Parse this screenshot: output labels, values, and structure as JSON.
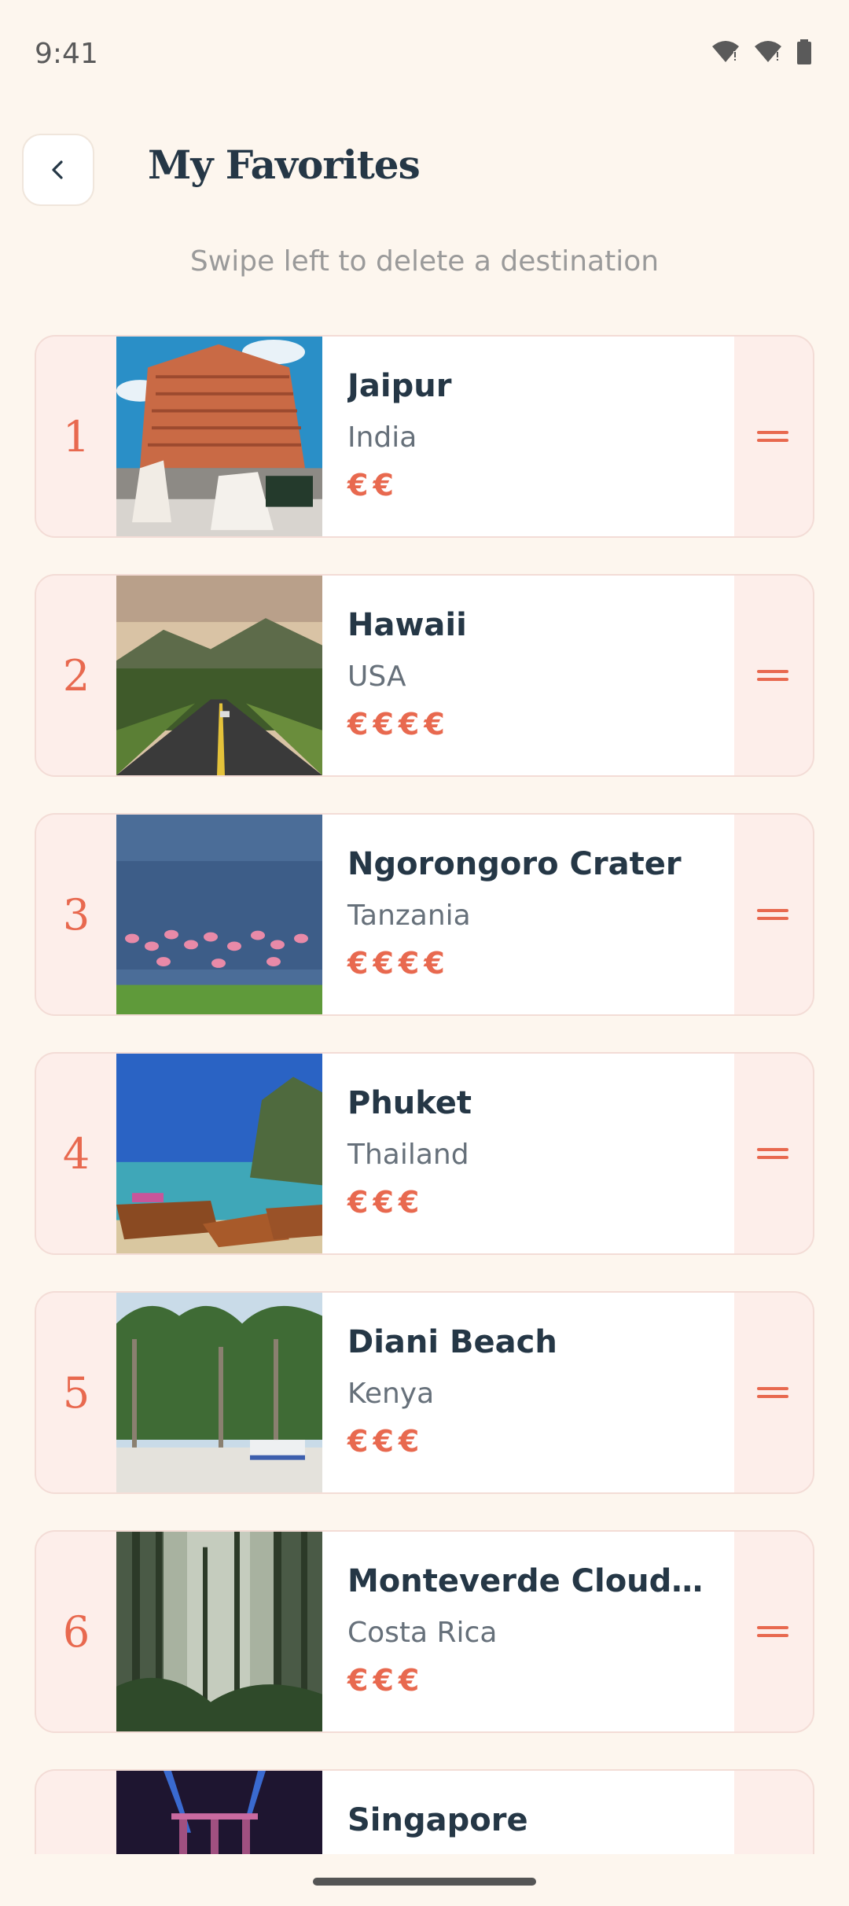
{
  "status_bar": {
    "time": "9:41"
  },
  "header": {
    "title": "My Favorites"
  },
  "hint": "Swipe left to delete a destination",
  "favorites": [
    {
      "rank": "1",
      "name": "Jaipur",
      "country": "India",
      "price": "€€"
    },
    {
      "rank": "2",
      "name": "Hawaii",
      "country": "USA",
      "price": "€€€€"
    },
    {
      "rank": "3",
      "name": "Ngorongoro Crater",
      "country": "Tanzania",
      "price": "€€€€"
    },
    {
      "rank": "4",
      "name": "Phuket",
      "country": "Thailand",
      "price": "€€€"
    },
    {
      "rank": "5",
      "name": "Diani Beach",
      "country": "Kenya",
      "price": "€€€"
    },
    {
      "rank": "6",
      "name": "Monteverde Cloud Fo…",
      "country": "Costa Rica",
      "price": "€€€"
    },
    {
      "rank": "",
      "name": "Singapore",
      "country": "",
      "price": ""
    }
  ],
  "colors": {
    "accent": "#e8694f",
    "background": "#fdf6ee",
    "card_tint": "#fdeeea",
    "text": "#253746"
  }
}
